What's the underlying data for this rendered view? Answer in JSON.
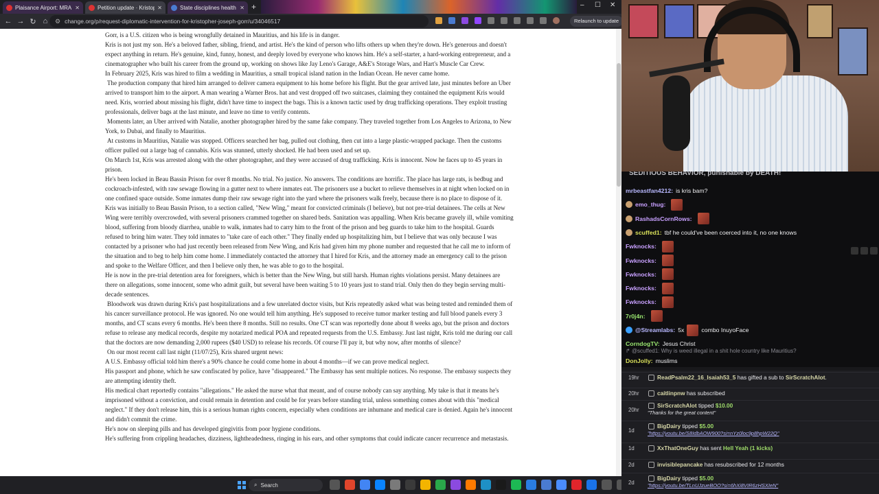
{
  "browser": {
    "tabs": [
      {
        "title": "Plaisance Airport: MRA Busted",
        "active": false,
        "favicon_color": "#d33333"
      },
      {
        "title": "Petition update · Kristopher's st",
        "active": true,
        "favicon_color": "#d33333"
      },
      {
        "title": "State disciplines health care pro",
        "active": false,
        "favicon_color": "#4a7bd1"
      }
    ],
    "url": "change.org/p/request-diplomatic-intervention-for-kristopher-joseph-gorr/u/34046517",
    "relaunch_label": "Relaunch to update",
    "window_controls": [
      "–",
      "☐",
      "✕"
    ]
  },
  "article": {
    "paragraphs": [
      "Gorr, is a U.S. citizen who is being wrongfully detained in Mauritius, and his life is in danger.",
      "Kris is not just my son. He's a beloved father, sibling, friend, and artist. He's the kind of person who lifts others up when they're down. He's generous and doesn't expect anything in return. He's genuine, kind, funny, honest, and deeply loved by everyone who knows him. He's a self-starter, a hard-working entrepreneur, and a cinematographer who built his career from the ground up, working on shows like Jay Leno's Garage, A&E's Storage Wars, and Hart's Muscle Car Crew.",
      "In February 2025, Kris was hired to film a wedding in Mauritius, a small tropical island nation in the Indian Ocean. He never came home.",
      "The production company that hired him arranged to deliver camera equipment to his home before his flight. But the gear arrived late, just minutes before an Uber arrived to transport him to the airport. A man wearing a Warner Bros. hat and vest dropped off two suitcases, claiming they contained the equipment Kris would need. Kris, worried about missing his flight, didn't have time to inspect the bags. This is a known tactic used by drug trafficking operations. They exploit trusting professionals, deliver bags at the last minute, and leave no time to verify contents.",
      "Moments later, an Uber arrived with Natalie, another photographer hired by the same fake company. They traveled together from Los Angeles to Arizona, to New York, to Dubai, and finally to Mauritius.",
      "At customs in Mauritius, Natalie was stopped. Officers searched her bag, pulled out clothing, then cut into a large plastic-wrapped package. Then the customs officer pulled out a large bag of cannabis. Kris was stunned, utterly shocked. He had been used and set up.",
      "On March 1st, Kris was arrested along with the other photographer, and they were accused of drug trafficking. Kris is innocent. Now he faces up to 45 years in prison.",
      "He's been locked in Beau Bassin Prison for over 8 months. No trial. No justice. No answers. The conditions are horrific. The place has large rats, is bedbug and cockroach-infested, with raw sewage flowing in a gutter next to where inmates eat. The prisoners use a bucket to relieve themselves in at night when locked on in one confined space outside. Some inmates dump their raw sewage right into the yard where the prisoners walk freely, because there is no place to dispose of it.",
      "Kris was initially to Beau Bassin Prison, to a section called, \"New Wing,\" meant for convicted criminals (I believe), but not pre-trial detainees. The cells at New Wing were terribly overcrowded, with several prisoners crammed together on shared beds. Sanitation was appalling. When Kris became gravely ill, while vomiting blood, suffering from bloody diarrhea, unable to walk, inmates had to carry him to the front of the prison and beg guards to take him to the hospital. Guards refused to bring him water. They told inmates to \"take care of each other.\" They finally ended up hospitalizing him, but I believe that was only because I was contacted by a prisoner who had just recently been released from New Wing, and Kris had given him my phone number and requested that he call me to inform of the situation and to beg to help him come home. I immediately contacted the attorney that I hired for Kris, and the attorney made an emergency call to the prison and spoke to the Welfare Officer, and then I believe only then, he was able to go to the hospital.",
      "He is now in the pre-trial detention area for foreigners, which is better than the New Wing, but still harsh. Human rights violations persist. Many detainees are there on allegations, some innocent, some who admit guilt, but several have been waiting 5 to 10 years just to stand trial. Only then do they begin serving multi-decade sentences.",
      "Bloodwork was drawn during Kris's past hospitalizations and a few unrelated doctor visits, but Kris repeatedly asked what was being tested and reminded them of his cancer surveillance protocol. He was ignored. No one would tell him anything. He's supposed to receive tumor marker testing and full blood panels every 3 months, and CT scans every 6 months. He's been there 8 months. Still no results. One CT scan was reportedly done about 8 weeks ago, but the prison and doctors refuse to release any medical records, despite my notarized medical POA and repeated requests from the U.S. Embassy. Just last night, Kris told me during our call that the doctors are now demanding 2,000 rupees ($40 USD) to release his records. Of course I'll pay it, but why now, after months of silence?",
      "On our most recent call last night (11/07/25), Kris shared urgent news:",
      "A U.S. Embassy official told him there's a 90% chance he could come home in about 4 months—if we can prove medical neglect.",
      "His passport and phone, which he saw confiscated by police, have \"disappeared.\" The Embassy has sent multiple notices. No response. The embassy suspects they are attempting identity theft.",
      "His medical chart reportedly contains \"allegations.\" He asked the nurse what that meant, and of course nobody can say anything. My take is that it means he's imprisoned without a conviction, and could remain in detention and could be for years before standing trial, unless something comes about with this \"medical neglect.\" If they don't release him, this is a serious human rights concern, especially when conditions are inhumane and medical care is denied. Again he's innocent and didn't commit the crime.",
      "He's now on sleeping pills and has developed gingivitis from poor hygiene conditions.",
      "He's suffering from crippling headaches, dizziness, lightheadedness, ringing in his ears, and other symptoms that could indicate cancer recurrence and metastasis."
    ]
  },
  "taskbar": {
    "search_placeholder": "Search",
    "icon_colors": [
      "#555",
      "#e0452c",
      "#4285f4",
      "#0a84ff",
      "#7a7a7a",
      "#3a3a3a",
      "#f3b400",
      "#2aa84a",
      "#8b4ae0",
      "#ff7a00",
      "#1e90c6",
      "#1a1a1a",
      "#1db954",
      "#2a7de1",
      "#4a7bd1",
      "#4a8dff",
      "#e2252b",
      "#1a73e8",
      "#555",
      "#555",
      "#2fb344"
    ]
  },
  "chat": {
    "top_line": "SEDITIOUS BEHAVIOR, punishable by DEATH!",
    "messages": [
      {
        "user": "mrbeastfan4212:",
        "color": "#b8b8ff",
        "text": "is kris bam?",
        "emotes": 0,
        "badge": ""
      },
      {
        "user": "emo_thug:",
        "color": "#c8a0ff",
        "text": "",
        "emotes": 1,
        "badge": "#c9a070"
      },
      {
        "user": "RashadsCornRows:",
        "color": "#c8a0ff",
        "text": "",
        "emotes": 1,
        "badge": "#c9a070"
      },
      {
        "user": "scuffed1:",
        "color": "#d9e05a",
        "text": "tbf he could've been coerced into it, no one knows",
        "emotes": 0,
        "badge": "#c9a070"
      },
      {
        "user": "Fwknocks:",
        "color": "#c8a0ff",
        "text": "",
        "emotes": 1,
        "badge": ""
      },
      {
        "user": "Fwknocks:",
        "color": "#c8a0ff",
        "text": "",
        "emotes": 1,
        "badge": ""
      },
      {
        "user": "Fwknocks:",
        "color": "#c8a0ff",
        "text": "",
        "emotes": 1,
        "badge": ""
      },
      {
        "user": "Fwknocks:",
        "color": "#c8a0ff",
        "text": "",
        "emotes": 1,
        "badge": ""
      },
      {
        "user": "Fwknocks:",
        "color": "#c8a0ff",
        "text": "",
        "emotes": 1,
        "badge": ""
      },
      {
        "user": "7r0j4n:",
        "color": "#9be870",
        "text": "",
        "emotes": 1,
        "badge": ""
      },
      {
        "user": "@Streamlabs:",
        "color": "#b8b8ff",
        "text": "5x",
        "emotes": 1,
        "badge": "#3aa0ff",
        "after": "combo InuyoFace"
      },
      {
        "user": "CorndogTV:",
        "color": "#9be870",
        "text": "Jesus Christ",
        "emotes": 0,
        "badge": ""
      }
    ],
    "reply_line": "@scuffed1: Why is weed illegal in a shit hole country like Mauritius?",
    "last_message": {
      "user": "DonJolly:",
      "color": "#d9e05a",
      "text": "muslims"
    }
  },
  "events": [
    {
      "time": "19hr",
      "who": "ReadPsalm22_16_Isaiah53_5",
      "text": " has gifted a sub to ",
      "who2": "SirScratchAlot",
      "tail": ".",
      "amount": "",
      "sub": ""
    },
    {
      "time": "20hr",
      "who": "caitlinpnw",
      "text": " has subscribed",
      "who2": "",
      "tail": "",
      "amount": "",
      "sub": ""
    },
    {
      "time": "20hr",
      "who": "SirScratchAlot",
      "text": " tipped ",
      "who2": "",
      "tail": "",
      "amount": "$10.00",
      "sub": "\"Thanks for the great content\""
    },
    {
      "time": "1d",
      "who": "BigDairy",
      "text": " tipped ",
      "who2": "",
      "tail": "",
      "amount": "$5.00",
      "sub": "\"https://youtu.be/S8IdbAOW900?si=nYz0loc9p8hpW22Q\""
    },
    {
      "time": "1d",
      "who": "XxThatOneGuy",
      "text": " has sent ",
      "who2": "",
      "tail": "",
      "amount": "Hell Yeah (1 kicks)",
      "sub": ""
    },
    {
      "time": "2d",
      "who": "invisiblepancake",
      "text": " has resubscribed for 12 months",
      "who2": "",
      "tail": "",
      "amount": "",
      "sub": ""
    },
    {
      "time": "2d",
      "who": "BigDairy",
      "text": " tipped ",
      "who2": "",
      "tail": "",
      "amount": "$5.00",
      "sub": "\"https://youtu.be/TLnUJzueBOO?si=6hXi8VIR6zHSXIeN\""
    }
  ]
}
